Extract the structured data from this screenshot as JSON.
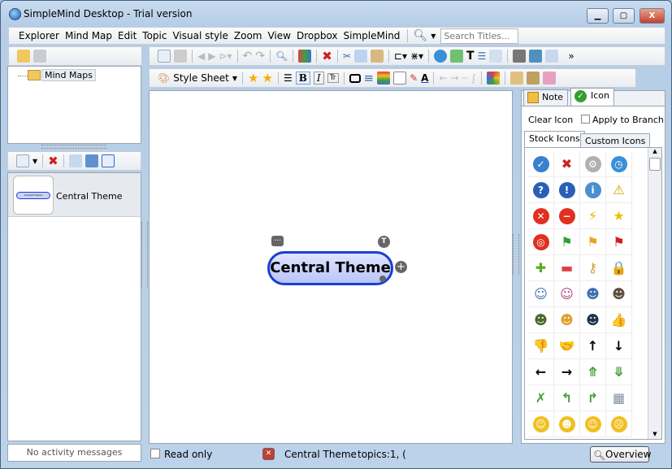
{
  "window": {
    "title": "SimpleMind Desktop - Trial version",
    "min": "▁",
    "max": "▢",
    "close": "X"
  },
  "menu": {
    "items": [
      "Explorer",
      "Mind Map",
      "Edit",
      "Topic",
      "Visual style",
      "Zoom",
      "View",
      "Dropbox",
      "SimpleMind"
    ],
    "search_placeholder": "Search Titles..."
  },
  "toolbar2": {
    "style_sheet": "Style Sheet",
    "more": "»"
  },
  "left": {
    "tree_root": "Mind Maps",
    "list_item": "Central Theme",
    "thumb_label": "Central Theme",
    "activity": "No activity messages"
  },
  "canvas": {
    "central_topic": "Central Theme"
  },
  "right": {
    "tabs": [
      "Note",
      "Icon"
    ],
    "clear_icon": "Clear Icon",
    "apply_to_branch": "Apply to Branch",
    "subtabs": [
      "Stock Icons",
      "Custom Icons"
    ],
    "icons": [
      {
        "n": "check",
        "c": "#3a7fd0",
        "g": "✓"
      },
      {
        "n": "cross",
        "c": "#ffffff",
        "g": "✖",
        "t": "#d02020"
      },
      {
        "n": "gear",
        "c": "#b0b0b0",
        "g": "⚙"
      },
      {
        "n": "clock",
        "c": "#3a8fd8",
        "g": "◷"
      },
      {
        "n": "question",
        "c": "#2a5fb8",
        "g": "?"
      },
      {
        "n": "exclamation",
        "c": "#2a5fb8",
        "g": "!"
      },
      {
        "n": "info",
        "c": "#4a8fd0",
        "g": "i"
      },
      {
        "n": "warning",
        "c": "#ffffff",
        "g": "⚠",
        "t": "#d0a000"
      },
      {
        "n": "error",
        "c": "#e03020",
        "g": "✕"
      },
      {
        "n": "minus-circle",
        "c": "#e03020",
        "g": "−"
      },
      {
        "n": "lightning",
        "c": "#ffffff",
        "g": "⚡",
        "t": "#e8b000"
      },
      {
        "n": "star",
        "c": "#ffffff",
        "g": "★",
        "t": "#f0c000"
      },
      {
        "n": "target",
        "c": "#e03020",
        "g": "◎"
      },
      {
        "n": "flag-green",
        "c": "#ffffff",
        "g": "⚑",
        "t": "#30a030"
      },
      {
        "n": "flag-orange",
        "c": "#ffffff",
        "g": "⚑",
        "t": "#f0a020"
      },
      {
        "n": "flag-red",
        "c": "#ffffff",
        "g": "⚑",
        "t": "#d02020"
      },
      {
        "n": "plus",
        "c": "#ffffff",
        "g": "✚",
        "t": "#50b020"
      },
      {
        "n": "minus",
        "c": "#ffffff",
        "g": "▬",
        "t": "#e04040"
      },
      {
        "n": "key",
        "c": "#ffffff",
        "g": "⚷",
        "t": "#d0a040"
      },
      {
        "n": "lock",
        "c": "#ffffff",
        "g": "🔒",
        "t": "#d0a040"
      },
      {
        "n": "user-male",
        "c": "#ffffff",
        "g": "☺",
        "t": "#4070b0"
      },
      {
        "n": "user-female",
        "c": "#ffffff",
        "g": "☺",
        "t": "#b04080"
      },
      {
        "n": "users",
        "c": "#ffffff",
        "g": "☻",
        "t": "#4070b0"
      },
      {
        "n": "user-business",
        "c": "#ffffff",
        "g": "☻",
        "t": "#605040"
      },
      {
        "n": "user-military",
        "c": "#ffffff",
        "g": "☻",
        "t": "#4a6a30"
      },
      {
        "n": "user-worker",
        "c": "#ffffff",
        "g": "☻",
        "t": "#e0a030"
      },
      {
        "n": "user-graduate",
        "c": "#ffffff",
        "g": "☻",
        "t": "#203050"
      },
      {
        "n": "thumbs-up",
        "c": "#ffffff",
        "g": "👍",
        "t": "#e0b040"
      },
      {
        "n": "thumbs-down",
        "c": "#ffffff",
        "g": "👎",
        "t": "#e0b040"
      },
      {
        "n": "handshake",
        "c": "#ffffff",
        "g": "🤝",
        "t": "#e0b040"
      },
      {
        "n": "arrow-up",
        "c": "#ffffff",
        "g": "↑",
        "t": "#000"
      },
      {
        "n": "arrow-down",
        "c": "#ffffff",
        "g": "↓",
        "t": "#000"
      },
      {
        "n": "arrow-left",
        "c": "#ffffff",
        "g": "←",
        "t": "#000"
      },
      {
        "n": "arrow-right",
        "c": "#ffffff",
        "g": "→",
        "t": "#000"
      },
      {
        "n": "arrows-merge",
        "c": "#ffffff",
        "g": "⤊",
        "t": "#40a030"
      },
      {
        "n": "arrows-split",
        "c": "#ffffff",
        "g": "⤋",
        "t": "#40a030"
      },
      {
        "n": "arrows-cross",
        "c": "#ffffff",
        "g": "✗",
        "t": "#40a030"
      },
      {
        "n": "arrow-turn-left",
        "c": "#ffffff",
        "g": "↰",
        "t": "#40a030"
      },
      {
        "n": "arrow-turn-right",
        "c": "#ffffff",
        "g": "↱",
        "t": "#40a030"
      },
      {
        "n": "brick-wall",
        "c": "#ffffff",
        "g": "▦",
        "t": "#8090a0"
      },
      {
        "n": "smiley",
        "c": "#f0c020",
        "g": "☺"
      },
      {
        "n": "grin",
        "c": "#f0c020",
        "g": "☻"
      },
      {
        "n": "smile-wink",
        "c": "#f0c020",
        "g": "☺"
      },
      {
        "n": "surprised",
        "c": "#f0c020",
        "g": "☹"
      }
    ]
  },
  "status": {
    "read_only": "Read only",
    "topic": "Central Theme",
    "topics": "topics:1, (",
    "overview": "Overview"
  },
  "colors": {
    "accent": "#1a3fd0",
    "topic_fill": "#c8d2fb"
  }
}
